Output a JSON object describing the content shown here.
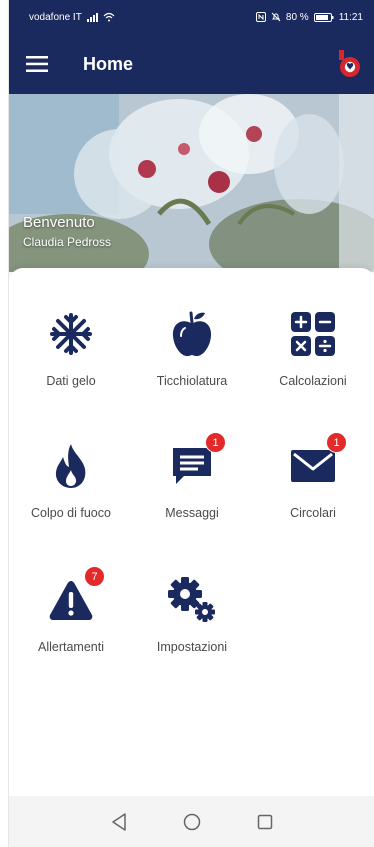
{
  "status_bar": {
    "carrier": "vodafone IT",
    "battery": "80 %",
    "time": "11:21"
  },
  "app_bar": {
    "title": "Home"
  },
  "hero": {
    "welcome": "Benvenuto",
    "user_name": "Claudia Pedross"
  },
  "tiles": [
    {
      "label": "Dati gelo",
      "icon": "snowflake-icon"
    },
    {
      "label": "Ticchiolatura",
      "icon": "apple-icon"
    },
    {
      "label": "Calcolazioni",
      "icon": "calculator-icon"
    },
    {
      "label": "Colpo di fuoco",
      "icon": "flame-icon"
    },
    {
      "label": "Messaggi",
      "icon": "message-icon",
      "badge": "1"
    },
    {
      "label": "Circolari",
      "icon": "envelope-icon",
      "badge": "1"
    },
    {
      "label": "Allertamenti",
      "icon": "warning-icon",
      "badge": "7"
    },
    {
      "label": "Impostazioni",
      "icon": "gears-icon"
    }
  ],
  "colors": {
    "primary": "#1b2a5e",
    "badge": "#e32a2a",
    "brand_red": "#d7262c"
  }
}
